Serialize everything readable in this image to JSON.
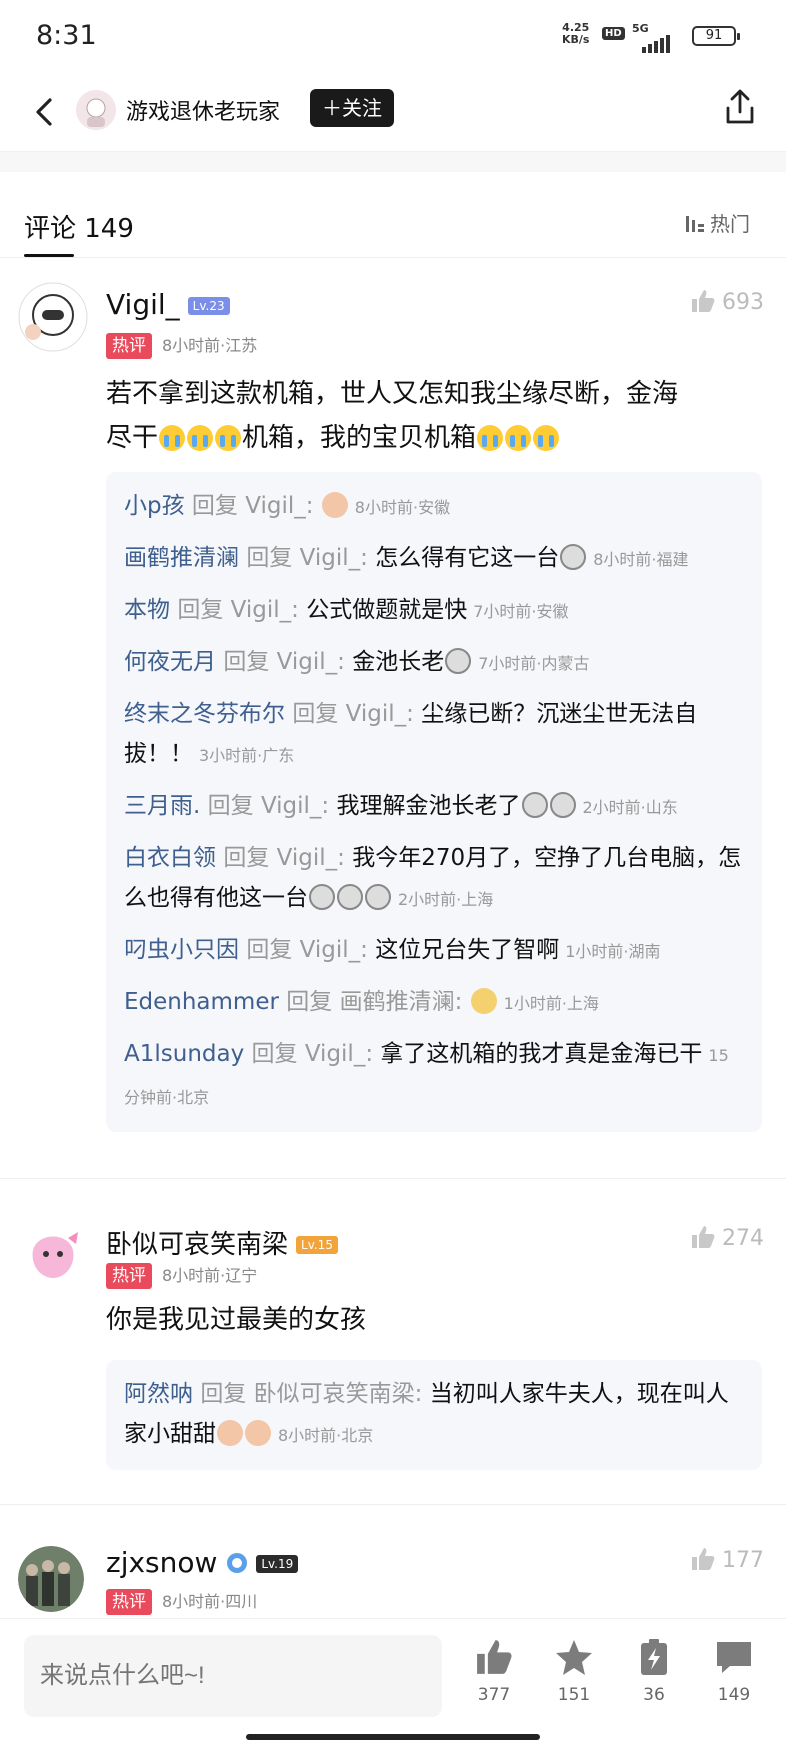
{
  "status_bar": {
    "time": "8:31",
    "net_speed": "4.25\nKB/s",
    "hd": "HD",
    "network": "5G",
    "battery": "91"
  },
  "header": {
    "author_name": "游戏退休老玩家",
    "follow_label": "＋关注"
  },
  "comments_header": {
    "title": "评论 149",
    "sort_label": "热门"
  },
  "comments": [
    {
      "user": "Vigil_",
      "level": "Lv.23",
      "level_color": "#7b8ee8",
      "hot_badge": "热评",
      "meta": "8小时前·江苏",
      "likes": "693",
      "text_lines": [
        "若不拿到这款机箱，世人又怎知我尘缘尽断，金海",
        "尽干",
        "机箱，我的宝贝机箱"
      ],
      "replies": [
        {
          "user": "小p孩",
          "reply_word": "回复",
          "target": "Vigil_:",
          "content": "",
          "time": "8小时前·安徽"
        },
        {
          "user": "画鹤推清澜",
          "reply_word": "回复",
          "target": "Vigil_:",
          "content": "怎么得有它这一台",
          "time": "8小时前·福建"
        },
        {
          "user": "本物",
          "reply_word": "回复",
          "target": "Vigil_:",
          "content": "公式做题就是快",
          "time": "7小时前·安徽"
        },
        {
          "user": "何夜无月",
          "reply_word": "回复",
          "target": "Vigil_:",
          "content": "金池长老",
          "time": "7小时前·内蒙古"
        },
        {
          "user": "终末之冬芬布尔",
          "reply_word": "回复",
          "target": "Vigil_:",
          "content": "尘缘已断？沉迷尘世无法自拔！！",
          "time": "3小时前·广东"
        },
        {
          "user": "三月雨.",
          "reply_word": "回复",
          "target": "Vigil_:",
          "content": "我理解金池长老了",
          "time": "2小时前·山东"
        },
        {
          "user": "白衣白领",
          "reply_word": "回复",
          "target": "Vigil_:",
          "content": "我今年270月了，空挣了几台电脑，怎么也得有他这一台",
          "time": "2小时前·上海"
        },
        {
          "user": "叼虫小只因",
          "reply_word": "回复",
          "target": "Vigil_:",
          "content": "这位兄台失了智啊",
          "time": "1小时前·湖南"
        },
        {
          "user": "Edenhammer",
          "reply_word": "回复",
          "target": "画鹤推清澜:",
          "content": "",
          "time": "1小时前·上海"
        },
        {
          "user": "A1lsunday",
          "reply_word": "回复",
          "target": "Vigil_:",
          "content": "拿了这机箱的我才真是金海已干",
          "time": "15分钟前·北京"
        }
      ]
    },
    {
      "user": "卧似可哀笑南梁",
      "level": "Lv.15",
      "level_color": "#f2a33a",
      "hot_badge": "热评",
      "meta": "8小时前·辽宁",
      "likes": "274",
      "text_lines": [
        "你是我见过最美的女孩"
      ],
      "replies": [
        {
          "user": "阿然呐",
          "reply_word": "回复",
          "target": "卧似可哀笑南梁:",
          "content": "当初叫人家牛夫人，现在叫人家小甜甜",
          "time": "8小时前·北京"
        }
      ]
    },
    {
      "user": "zjxsnow",
      "level": "Lv.19",
      "level_color": "#2b2b2b",
      "hot_badge": "热评",
      "meta": "8小时前·四川",
      "likes": "177"
    }
  ],
  "bottom_bar": {
    "input_placeholder": "来说点什么吧~!",
    "like_count": "377",
    "star_count": "151",
    "charge_count": "36",
    "comment_count": "149"
  }
}
